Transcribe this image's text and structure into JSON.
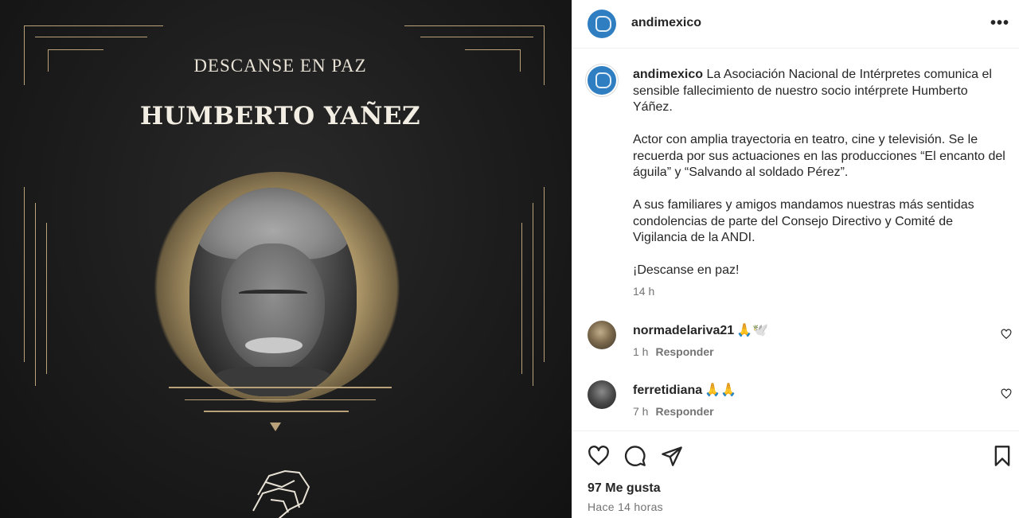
{
  "post_image": {
    "subtitle": "DESCANSE EN PAZ",
    "name": "HUMBERTO YAÑEZ",
    "accent_color": "#b9a27a"
  },
  "header": {
    "username": "andimexico",
    "more_label": "•••"
  },
  "caption": {
    "username": "andimexico",
    "paragraphs": [
      "La Asociación Nacional de Intérpretes comunica el sensible fallecimiento de nuestro socio intérprete Humberto Yáñez.",
      "Actor con amplia trayectoria en teatro, cine y televisión. Se le recuerda por sus actuaciones en las producciones “El encanto del águila” y “Salvando al soldado Pérez”.",
      "A sus familiares y amigos mandamos nuestras más sentidas condolencias de parte del Consejo Directivo y Comité de Vigilancia de la ANDI.",
      "¡Descanse en paz!"
    ],
    "time": "14 h"
  },
  "comments": [
    {
      "username": "normadelariva21",
      "emoji": "🙏🕊️",
      "time": "1 h",
      "reply_label": "Responder"
    },
    {
      "username": "ferretidiana",
      "emoji": "🙏🙏",
      "time": "7 h",
      "reply_label": "Responder"
    }
  ],
  "actions": {
    "likes": "97 Me gusta",
    "posted": "Hace 14 horas"
  }
}
